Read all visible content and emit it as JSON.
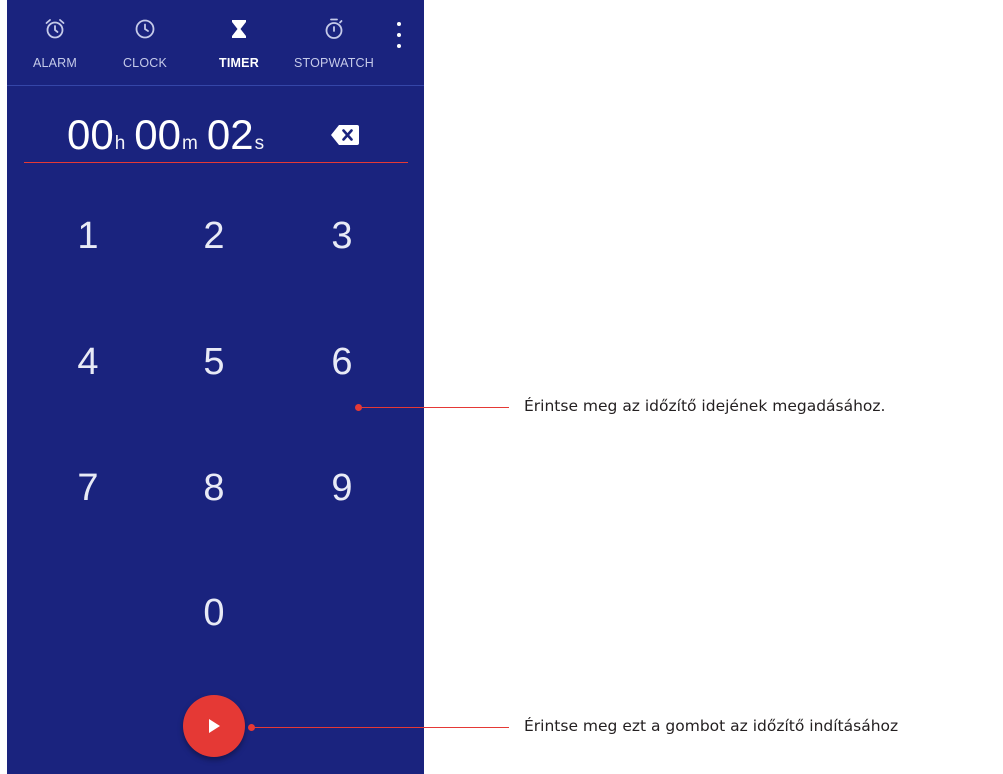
{
  "tabs": {
    "alarm": {
      "label": "ALARM",
      "icon": "alarm-clock-icon"
    },
    "clock": {
      "label": "CLOCK",
      "icon": "clock-icon"
    },
    "timer": {
      "label": "TIMER",
      "icon": "hourglass-icon",
      "active": true
    },
    "stopwatch": {
      "label": "STOPWATCH",
      "icon": "stopwatch-icon"
    }
  },
  "timer": {
    "hours": "00",
    "hours_unit": "h",
    "minutes": "00",
    "minutes_unit": "m",
    "seconds": "02",
    "seconds_unit": "s"
  },
  "keypad": {
    "k1": "1",
    "k2": "2",
    "k3": "3",
    "k4": "4",
    "k5": "5",
    "k6": "6",
    "k7": "7",
    "k8": "8",
    "k9": "9",
    "k0": "0"
  },
  "callouts": {
    "keypad": "Érintse meg az időzítő idejének megadásához.",
    "start": "Érintse meg ezt a gombot az időzítő indításához"
  },
  "colors": {
    "background": "#1a237e",
    "accent": "#e53935",
    "text": "#ffffff"
  }
}
